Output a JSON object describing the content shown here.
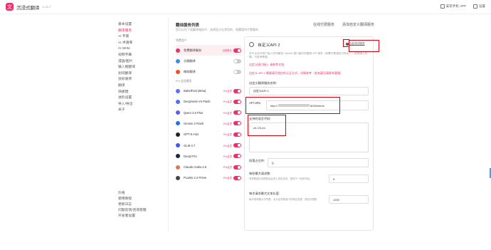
{
  "app": {
    "name": "沉浸式翻译",
    "version": "1.21.7"
  },
  "topbar": {
    "mobile_app": "安装手机 APP",
    "settings": "设置"
  },
  "sidebar": {
    "items": [
      {
        "label": "基本设置",
        "active": false
      },
      {
        "label": "翻译服务",
        "active": true
      },
      {
        "label": "AI 专家",
        "active": false
      },
      {
        "label": "AI 术语库",
        "active": false
      },
      {
        "label": "AI Write",
        "active": false
      },
      {
        "label": "视频字幕",
        "active": false
      },
      {
        "label": "漫画/图片",
        "active": false
      },
      {
        "label": "输入框翻译",
        "active": false
      },
      {
        "label": "划词翻译",
        "active": false
      },
      {
        "label": "鼠标悬停",
        "active": false
      },
      {
        "label": "翻译",
        "active": false
      },
      {
        "label": "快捷键",
        "active": false
      },
      {
        "label": "进阶设置",
        "active": false
      },
      {
        "label": "导入/导出",
        "active": false
      },
      {
        "label": "关于",
        "active": false
      }
    ],
    "bottom": [
      "价格",
      "使用教程",
      "更新日志",
      "问题反馈/咨询客服",
      "开发者设置"
    ]
  },
  "header": {
    "title": "翻译服务列表",
    "subtitle": "您可以在下面翻译服务中，选择显示在常用的，隐藏暂时不需要的",
    "links": [
      "在线付费服务",
      "添加自定义翻译服务"
    ]
  },
  "services": {
    "group_free": "免费用户",
    "group_pro": "Pro 会员模型",
    "free": [
      {
        "name": "免费翻译服务",
        "badge": "当前默认",
        "on": true,
        "color": "#e8336b"
      },
      {
        "name": "谷歌翻译",
        "badge": "",
        "on": false,
        "color": "#4285f4"
      },
      {
        "name": "微软翻译",
        "badge": "",
        "on": false,
        "color": "#f25022"
      }
    ],
    "pro": [
      {
        "name": "BabelFast (Beta)",
        "badge": "Pro会员",
        "on": true,
        "color": "#5b6cff"
      },
      {
        "name": "DeepSeek-V4-Flash",
        "badge": "Pro会员",
        "on": true,
        "color": "#4d6bfe"
      },
      {
        "name": "Qwen 3.5 Plus",
        "badge": "Pro会员",
        "on": true,
        "color": "#615ced"
      },
      {
        "name": "Gemini 3 Flash",
        "badge": "Pro会员",
        "on": true,
        "color": "#1a73e8"
      },
      {
        "name": "GPT-5 mini",
        "badge": "Pro会员",
        "on": true,
        "color": "#222222"
      },
      {
        "name": "GLM-4.7",
        "badge": "Pro会员",
        "on": true,
        "color": "#3859ff"
      },
      {
        "name": "Deepl Pro",
        "badge": "Pro会员",
        "on": true,
        "color": "#0f2b46"
      },
      {
        "name": "Claude Haiku 4.5",
        "badge": "Pro会员",
        "on": true,
        "color": "#d97757"
      },
      {
        "name": "PLaMo 2.2 Prime",
        "badge": "Pro会员",
        "on": true,
        "color": "#444444"
      }
    ]
  },
  "panel": {
    "title": "自定义API 2",
    "test_link": "点此测试服务",
    "description": "本平台允许用户接入任何兼容 OpenAI 接口格式的翻译 API 服务（如需付费请自行购买），如有接入问题，可参考教程。",
    "note": "自定义接口接入 请参考文档",
    "link2": "自定义 API 2 需要填写相应的认证方式、详情参考（若有疑问请联系客服）",
    "fields": {
      "name_label": "自定义翻译服务名称:",
      "name_value": "自定义API 2",
      "api_url_label": "API URL:",
      "api_url_prefix": "http://",
      "api_url_suffix": "8000/mime",
      "lang_label": "支持的语言代码:",
      "lang_value": "zh-CN,en",
      "placeholder_label": "段落占位符:",
      "placeholder_value": "{}",
      "max_req_label": "每秒最大请求数:",
      "max_req_hint": "请求数超过该限制后会进入排队状态，直到下一秒钟开始。",
      "max_req_value": "5",
      "max_text_label": "每次请求最大文本长度:",
      "max_text_hint": "每次请求最大字符数，太大会导致接口的响应变慢，请尝试调整",
      "max_text_value": "1200"
    }
  }
}
